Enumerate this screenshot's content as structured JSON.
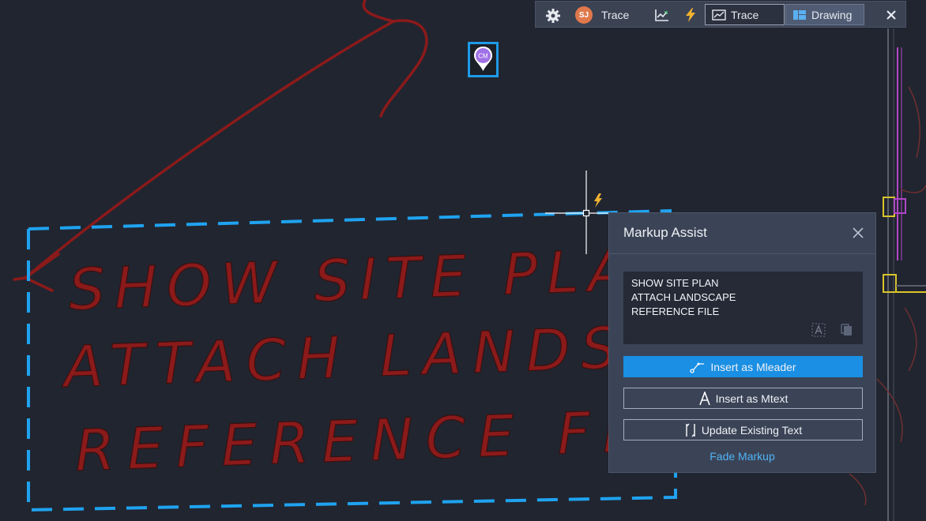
{
  "toolbar": {
    "settings_icon": "gear-icon",
    "avatar_initials": "SJ",
    "avatar_color": "#e0784b",
    "trace_label": "Trace",
    "compare_icon": "chart-compare-icon",
    "markup_assist_icon": "lightning-icon",
    "segments": [
      {
        "label": "Trace",
        "icon": "trace-view-icon",
        "selected": false
      },
      {
        "label": "Drawing",
        "icon": "drawing-view-icon",
        "selected": true
      }
    ],
    "close_icon": "close-icon"
  },
  "pin": {
    "initials": "CM",
    "color": "#a070e6"
  },
  "handwriting": {
    "lines": [
      "SHOW SITE PLAN",
      "ATTACH LANDSCAPE",
      "REFERENCE FILE"
    ],
    "ink_color": "#8b1a1a"
  },
  "panel": {
    "title": "Markup Assist",
    "recognized_text": [
      "SHOW SITE PLAN",
      "ATTACH LANDSCAPE",
      "REFERENCE FILE"
    ],
    "buttons": {
      "mleader": "Insert as Mleader",
      "mtext": "Insert as Mtext",
      "update": "Update Existing Text"
    },
    "fade_link": "Fade Markup"
  },
  "colors": {
    "background": "#212530",
    "accent": "#1a8fe3",
    "selection": "#1fa3f0",
    "panel": "#3b4456"
  }
}
